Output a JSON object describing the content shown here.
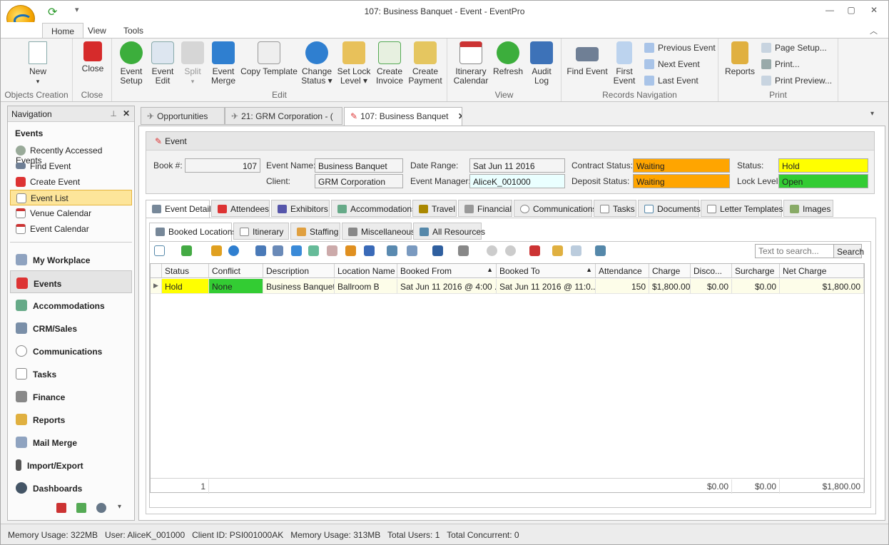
{
  "window": {
    "title": "107: Business Banquet - Event - EventPro"
  },
  "ribbon_tabs": [
    "Home",
    "View",
    "Tools"
  ],
  "ribbon": {
    "new": "New",
    "close": "Close",
    "objects_creation": "Objects Creation",
    "close_group": "Close",
    "event_setup": [
      "Event",
      "Setup"
    ],
    "event_edit": [
      "Event",
      "Edit"
    ],
    "split": "Split",
    "event_merge": [
      "Event",
      "Merge"
    ],
    "copy_template": "Copy Template",
    "change_status": [
      "Change",
      "Status"
    ],
    "set_lock_level": [
      "Set Lock",
      "Level"
    ],
    "create_invoice": [
      "Create",
      "Invoice"
    ],
    "create_payment": [
      "Create",
      "Payment"
    ],
    "edit_group": "Edit",
    "itinerary_calendar": [
      "Itinerary",
      "Calendar"
    ],
    "refresh": "Refresh",
    "audit_log": [
      "Audit",
      "Log"
    ],
    "view_group": "View",
    "find_event": "Find Event",
    "first_event": [
      "First",
      "Event"
    ],
    "previous_event": "Previous Event",
    "next_event": "Next Event",
    "last_event": "Last Event",
    "records_group": "Records Navigation",
    "reports": "Reports",
    "page_setup": "Page Setup...",
    "print": "Print...",
    "print_preview": "Print Preview...",
    "print_group": "Print"
  },
  "nav": {
    "header": "Navigation",
    "section": "Events",
    "items": [
      "Recently Accessed Events",
      "Find Event",
      "Create Event",
      "Event List",
      "Venue Calendar",
      "Event Calendar"
    ],
    "groups": [
      "My Workplace",
      "Events",
      "Accommodations",
      "CRM/Sales",
      "Communications",
      "Tasks",
      "Finance",
      "Reports",
      "Mail Merge",
      "Import/Export",
      "Dashboards"
    ]
  },
  "doc_tabs": [
    "Opportunities",
    "21: GRM Corporation - (",
    "107: Business Banquet"
  ],
  "event": {
    "panel_title": "Event",
    "book_label": "Book #:",
    "book": "107",
    "name_label": "Event Name:",
    "name": "Business Banquet",
    "client_label": "Client:",
    "client": "GRM Corporation",
    "date_label": "Date Range:",
    "date": "Sat Jun 11 2016",
    "manager_label": "Event Manager:",
    "manager": "AliceK_001000",
    "contract_label": "Contract Status:",
    "contract": "Waiting",
    "deposit_label": "Deposit Status:",
    "deposit": "Waiting",
    "status_label": "Status:",
    "status": "Hold",
    "lock_label": "Lock Level:",
    "lock": "Open"
  },
  "section_tabs": [
    "Event Detail",
    "Attendees",
    "Exhibitors",
    "Accommodations",
    "Travel",
    "Financial",
    "Communications",
    "Tasks",
    "Documents",
    "Letter Templates",
    "Images"
  ],
  "sub_tabs": [
    "Booked Locations",
    "Itinerary",
    "Staffing",
    "Miscellaneous",
    "All Resources"
  ],
  "search": {
    "placeholder": "Text to search...",
    "button": "Search"
  },
  "grid": {
    "columns": [
      "Status",
      "Conflict",
      "Description",
      "Location Name",
      "Booked From",
      "Booked To",
      "Attendance",
      "Charge",
      "Disco...",
      "Surcharge",
      "Net Charge"
    ],
    "rows": [
      [
        "Hold",
        "None",
        "Business Banquet",
        "Ballroom B",
        "Sat Jun 11 2016 @ 4:00 ...",
        "Sat Jun 11 2016 @ 11:0...",
        "150",
        "$1,800.00",
        "$0.00",
        "$0.00",
        "$1,800.00"
      ]
    ],
    "footer": {
      "count": "1",
      "discount": "$0.00",
      "surcharge": "$0.00",
      "net": "$1,800.00"
    }
  },
  "statusbar": {
    "text": "Memory Usage: 322MB   User: AliceK_001000   Client ID: PSI001000AK   Memory Usage: 313MB   Total Users: 1   Total Concurrent: 0"
  },
  "colors": {
    "waiting": "#ffa500",
    "hold": "#ffff00",
    "open": "#33cc33",
    "accent": "#f5c542"
  }
}
